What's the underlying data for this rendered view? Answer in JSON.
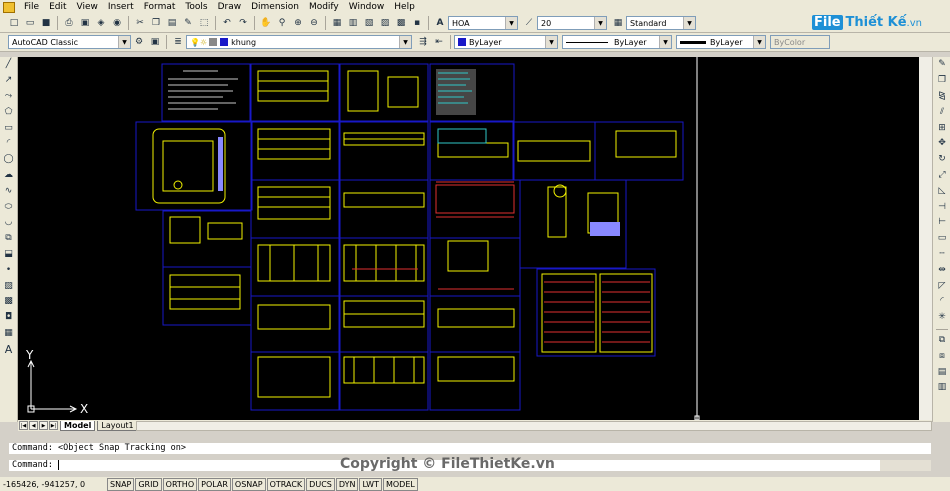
{
  "menu": [
    "File",
    "Edit",
    "View",
    "Insert",
    "Format",
    "Tools",
    "Draw",
    "Dimension",
    "Modify",
    "Window",
    "Help"
  ],
  "toolbar1": {
    "text_style": "HOA",
    "dim_style": "20",
    "table_style": "Standard"
  },
  "toolbar2": {
    "workspace": "AutoCAD Classic",
    "layer": "khung",
    "color": "ByLayer",
    "linetype": "ByLayer",
    "lineweight": "ByLayer",
    "plot_style": "ByColor"
  },
  "logo": {
    "part1": "File",
    "part2": "Thiết Kế",
    "suffix": ".vn"
  },
  "ucs": {
    "x": "X",
    "y": "Y"
  },
  "tabs": [
    "Model",
    "Layout1"
  ],
  "command": {
    "history": "Command:  <Object Snap Tracking on>",
    "prompt": "Command:"
  },
  "status": {
    "coords": "-165426, -941257, 0",
    "toggles": [
      "SNAP",
      "GRID",
      "ORTHO",
      "POLAR",
      "OSNAP",
      "OTRACK",
      "DUCS",
      "DYN",
      "LWT",
      "MODEL"
    ]
  },
  "watermark": "Copyright © FileThietKe.vn",
  "colors": {
    "canvas": "#000000",
    "frame": "#1818c8",
    "accent_yellow": "#f2f200",
    "accent_red": "#e03030"
  }
}
